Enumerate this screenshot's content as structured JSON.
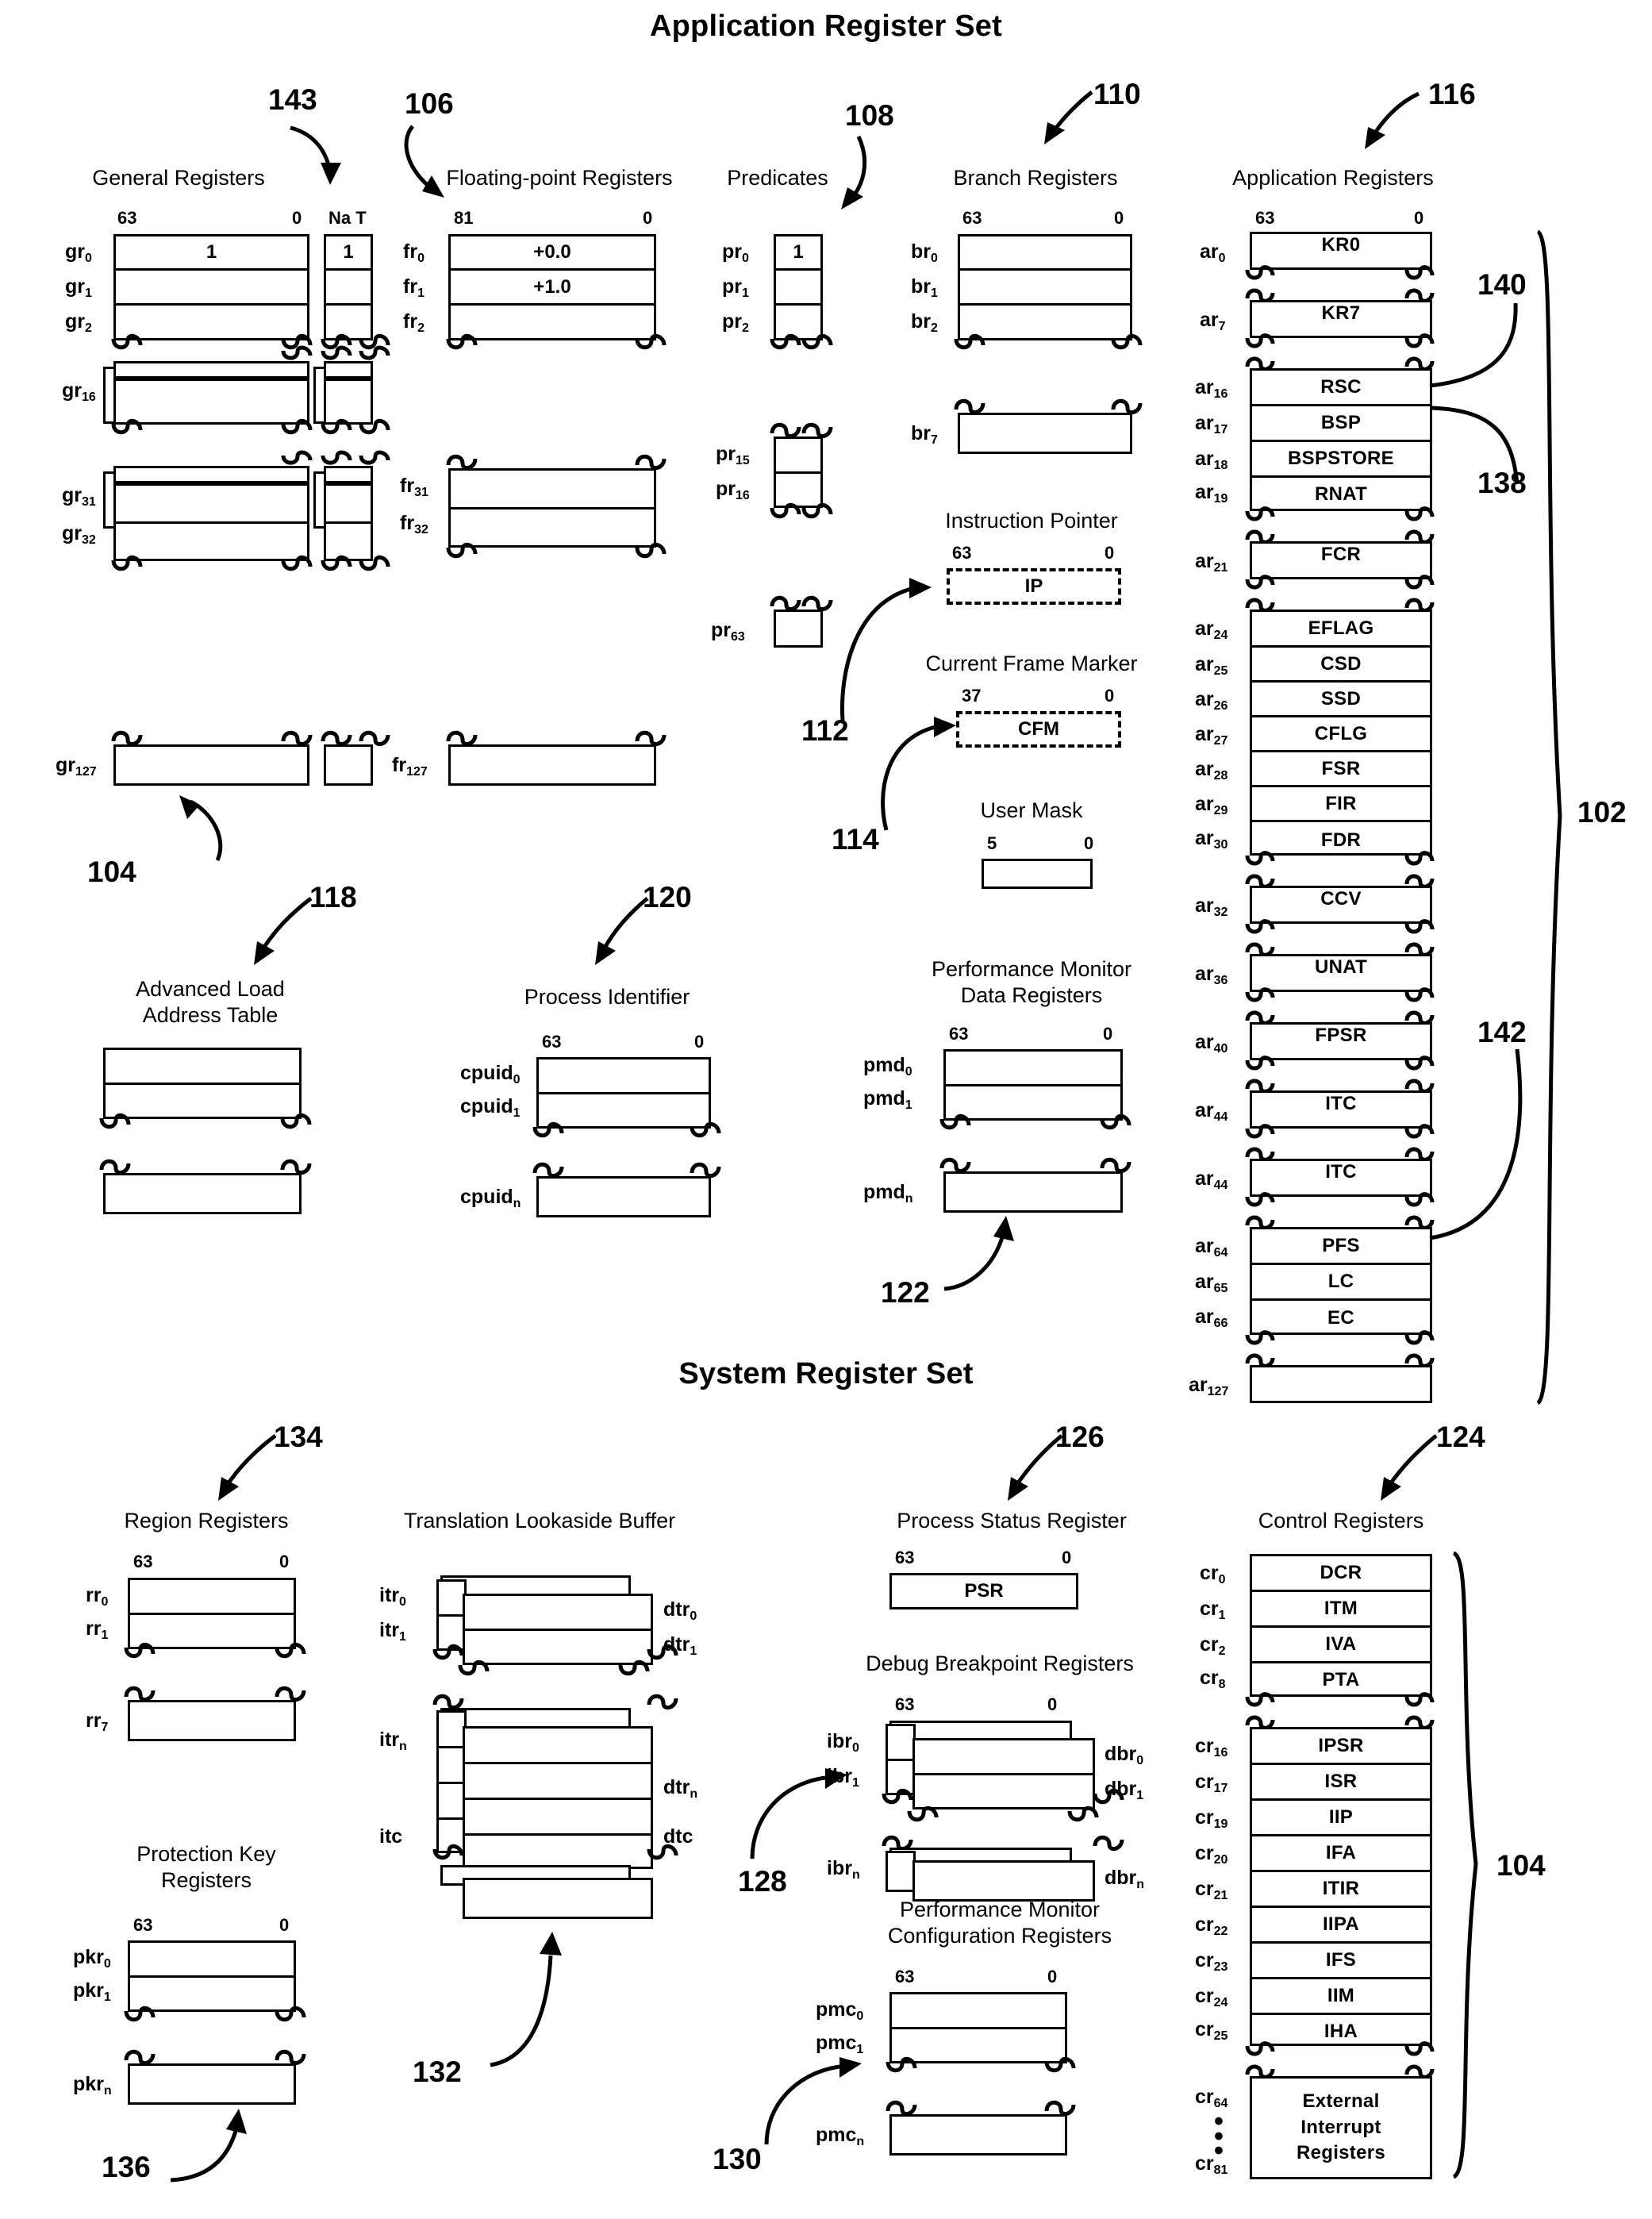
{
  "sections": {
    "app": {
      "title": "Application Register Set",
      "ref": "102"
    },
    "sys": {
      "title": "System Register Set",
      "ref": "104"
    }
  },
  "bits": {
    "b63": "63",
    "b0": "0",
    "b81": "81",
    "b37": "37",
    "b5": "5",
    "nat": "Na T"
  },
  "groups": {
    "general_registers": {
      "title": "General Registers",
      "ref_arrow": "143",
      "ref_below": "104",
      "hi": "63",
      "lo": "0",
      "nat": "Na T",
      "rows": [
        "gr0",
        "gr1",
        "gr2",
        "gr16",
        "gr31",
        "gr32",
        "gr127"
      ],
      "labels": {
        "gr0": "gr",
        "sub0": "0",
        "sub1": "1",
        "sub2": "2",
        "sub16": "16",
        "sub31": "31",
        "sub32": "32",
        "sub127": "127"
      },
      "value_gr0": "1",
      "value_nat0": "1"
    },
    "floating_point_registers": {
      "title": "Floating-point Registers",
      "ref": "106",
      "hi": "81",
      "lo": "0",
      "values": {
        "fr0": "+0.0",
        "fr1": "+1.0"
      },
      "row_subs": [
        "0",
        "1",
        "2",
        "31",
        "32",
        "127"
      ]
    },
    "predicates": {
      "title": "Predicates",
      "ref": "108",
      "value_pr0": "1",
      "row_subs": [
        "0",
        "1",
        "2",
        "15",
        "16",
        "63"
      ]
    },
    "branch_registers": {
      "title": "Branch Registers",
      "ref": "110",
      "hi": "63",
      "lo": "0",
      "row_subs": [
        "0",
        "1",
        "2",
        "7"
      ]
    },
    "instruction_pointer": {
      "title": "Instruction Pointer",
      "ref": "112",
      "hi": "63",
      "lo": "0",
      "value": "IP"
    },
    "current_frame_marker": {
      "title": "Current Frame Marker",
      "ref": "114",
      "hi": "37",
      "lo": "0",
      "value": "CFM"
    },
    "user_mask": {
      "title": "User Mask",
      "hi": "5",
      "lo": "0"
    },
    "application_registers": {
      "title": "Application Registers",
      "ref": "116",
      "hi": "63",
      "lo": "0",
      "ref_140": "140",
      "ref_138": "138",
      "ref_142": "142",
      "ref_102": "102",
      "rows": [
        {
          "idx": "0",
          "name": "KR0"
        },
        {
          "idx": "7",
          "name": "KR7"
        },
        {
          "idx": "16",
          "name": "RSC"
        },
        {
          "idx": "17",
          "name": "BSP"
        },
        {
          "idx": "18",
          "name": "BSPSTORE"
        },
        {
          "idx": "19",
          "name": "RNAT"
        },
        {
          "idx": "21",
          "name": "FCR"
        },
        {
          "idx": "24",
          "name": "EFLAG"
        },
        {
          "idx": "25",
          "name": "CSD"
        },
        {
          "idx": "26",
          "name": "SSD"
        },
        {
          "idx": "27",
          "name": "CFLG"
        },
        {
          "idx": "28",
          "name": "FSR"
        },
        {
          "idx": "29",
          "name": "FIR"
        },
        {
          "idx": "30",
          "name": "FDR"
        },
        {
          "idx": "32",
          "name": "CCV"
        },
        {
          "idx": "36",
          "name": "UNAT"
        },
        {
          "idx": "40",
          "name": "FPSR"
        },
        {
          "idx": "44",
          "name": "ITC"
        },
        {
          "idx": "44b",
          "name": "ITC"
        },
        {
          "idx": "64",
          "name": "PFS"
        },
        {
          "idx": "65",
          "name": "LC"
        },
        {
          "idx": "66",
          "name": "EC"
        },
        {
          "idx": "127",
          "name": ""
        }
      ]
    },
    "advanced_load_address_table": {
      "title_l1": "Advanced Load",
      "title_l2": "Address Table",
      "ref": "118"
    },
    "process_identifier": {
      "title": "Process Identifier",
      "ref": "120",
      "hi": "63",
      "lo": "0",
      "row_subs": [
        "0",
        "1",
        "n"
      ],
      "prefix": "cpuid"
    },
    "performance_monitor_data_registers": {
      "title_l1": "Performance Monitor",
      "title_l2": "Data Registers",
      "ref": "122",
      "hi": "63",
      "lo": "0",
      "row_subs": [
        "0",
        "1",
        "n"
      ],
      "prefix": "pmd"
    },
    "region_registers": {
      "title": "Region Registers",
      "ref": "134",
      "hi": "63",
      "lo": "0",
      "row_subs": [
        "0",
        "1",
        "7"
      ],
      "prefix": "rr"
    },
    "translation_lookaside_buffer": {
      "title": "Translation Lookaside Buffer",
      "ref": "132",
      "left_labels": [
        "itr0",
        "itr1",
        "itrn",
        "itc"
      ],
      "right_labels": [
        "dtr0",
        "dtr1",
        "dtrn",
        "dtc"
      ],
      "left_prefix": "itr",
      "right_prefix": "dtr",
      "left_last": "itc",
      "right_last": "dtc",
      "subs": [
        "0",
        "1",
        "n"
      ]
    },
    "protection_key_registers": {
      "title_l1": "Protection Key",
      "title_l2": "Registers",
      "ref": "136",
      "hi": "63",
      "lo": "0",
      "row_subs": [
        "0",
        "1",
        "n"
      ],
      "prefix": "pkr"
    },
    "process_status_register": {
      "title": "Process Status Register",
      "ref": "126",
      "hi": "63",
      "lo": "0",
      "value": "PSR"
    },
    "debug_breakpoint_registers": {
      "title": "Debug Breakpoint Registers",
      "ref": "128",
      "hi": "63",
      "lo": "0",
      "left_prefix": "ibr",
      "right_prefix": "dbr",
      "subs": [
        "0",
        "1",
        "n"
      ]
    },
    "performance_monitor_configuration_registers": {
      "title_l1": "Performance Monitor",
      "title_l2": "Configuration Registers",
      "ref": "130",
      "hi": "63",
      "lo": "0",
      "row_subs": [
        "0",
        "1",
        "n"
      ],
      "prefix": "pmc"
    },
    "control_registers": {
      "title": "Control Registers",
      "ref": "124",
      "ref_brace": "104",
      "rows": [
        {
          "idx": "0",
          "name": "DCR"
        },
        {
          "idx": "1",
          "name": "ITM"
        },
        {
          "idx": "2",
          "name": "IVA"
        },
        {
          "idx": "8",
          "name": "PTA"
        },
        {
          "idx": "16",
          "name": "IPSR"
        },
        {
          "idx": "17",
          "name": "ISR"
        },
        {
          "idx": "19",
          "name": "IIP"
        },
        {
          "idx": "20",
          "name": "IFA"
        },
        {
          "idx": "21",
          "name": "ITIR"
        },
        {
          "idx": "22",
          "name": "IIPA"
        },
        {
          "idx": "23",
          "name": "IFS"
        },
        {
          "idx": "24",
          "name": "IIM"
        },
        {
          "idx": "25",
          "name": "IHA"
        }
      ],
      "ext_l1": "External",
      "ext_l2": "Interrupt",
      "ext_l3": "Registers",
      "ext_start": "64",
      "ext_end": "81",
      "ext_dots": "•\n•\n•"
    }
  }
}
